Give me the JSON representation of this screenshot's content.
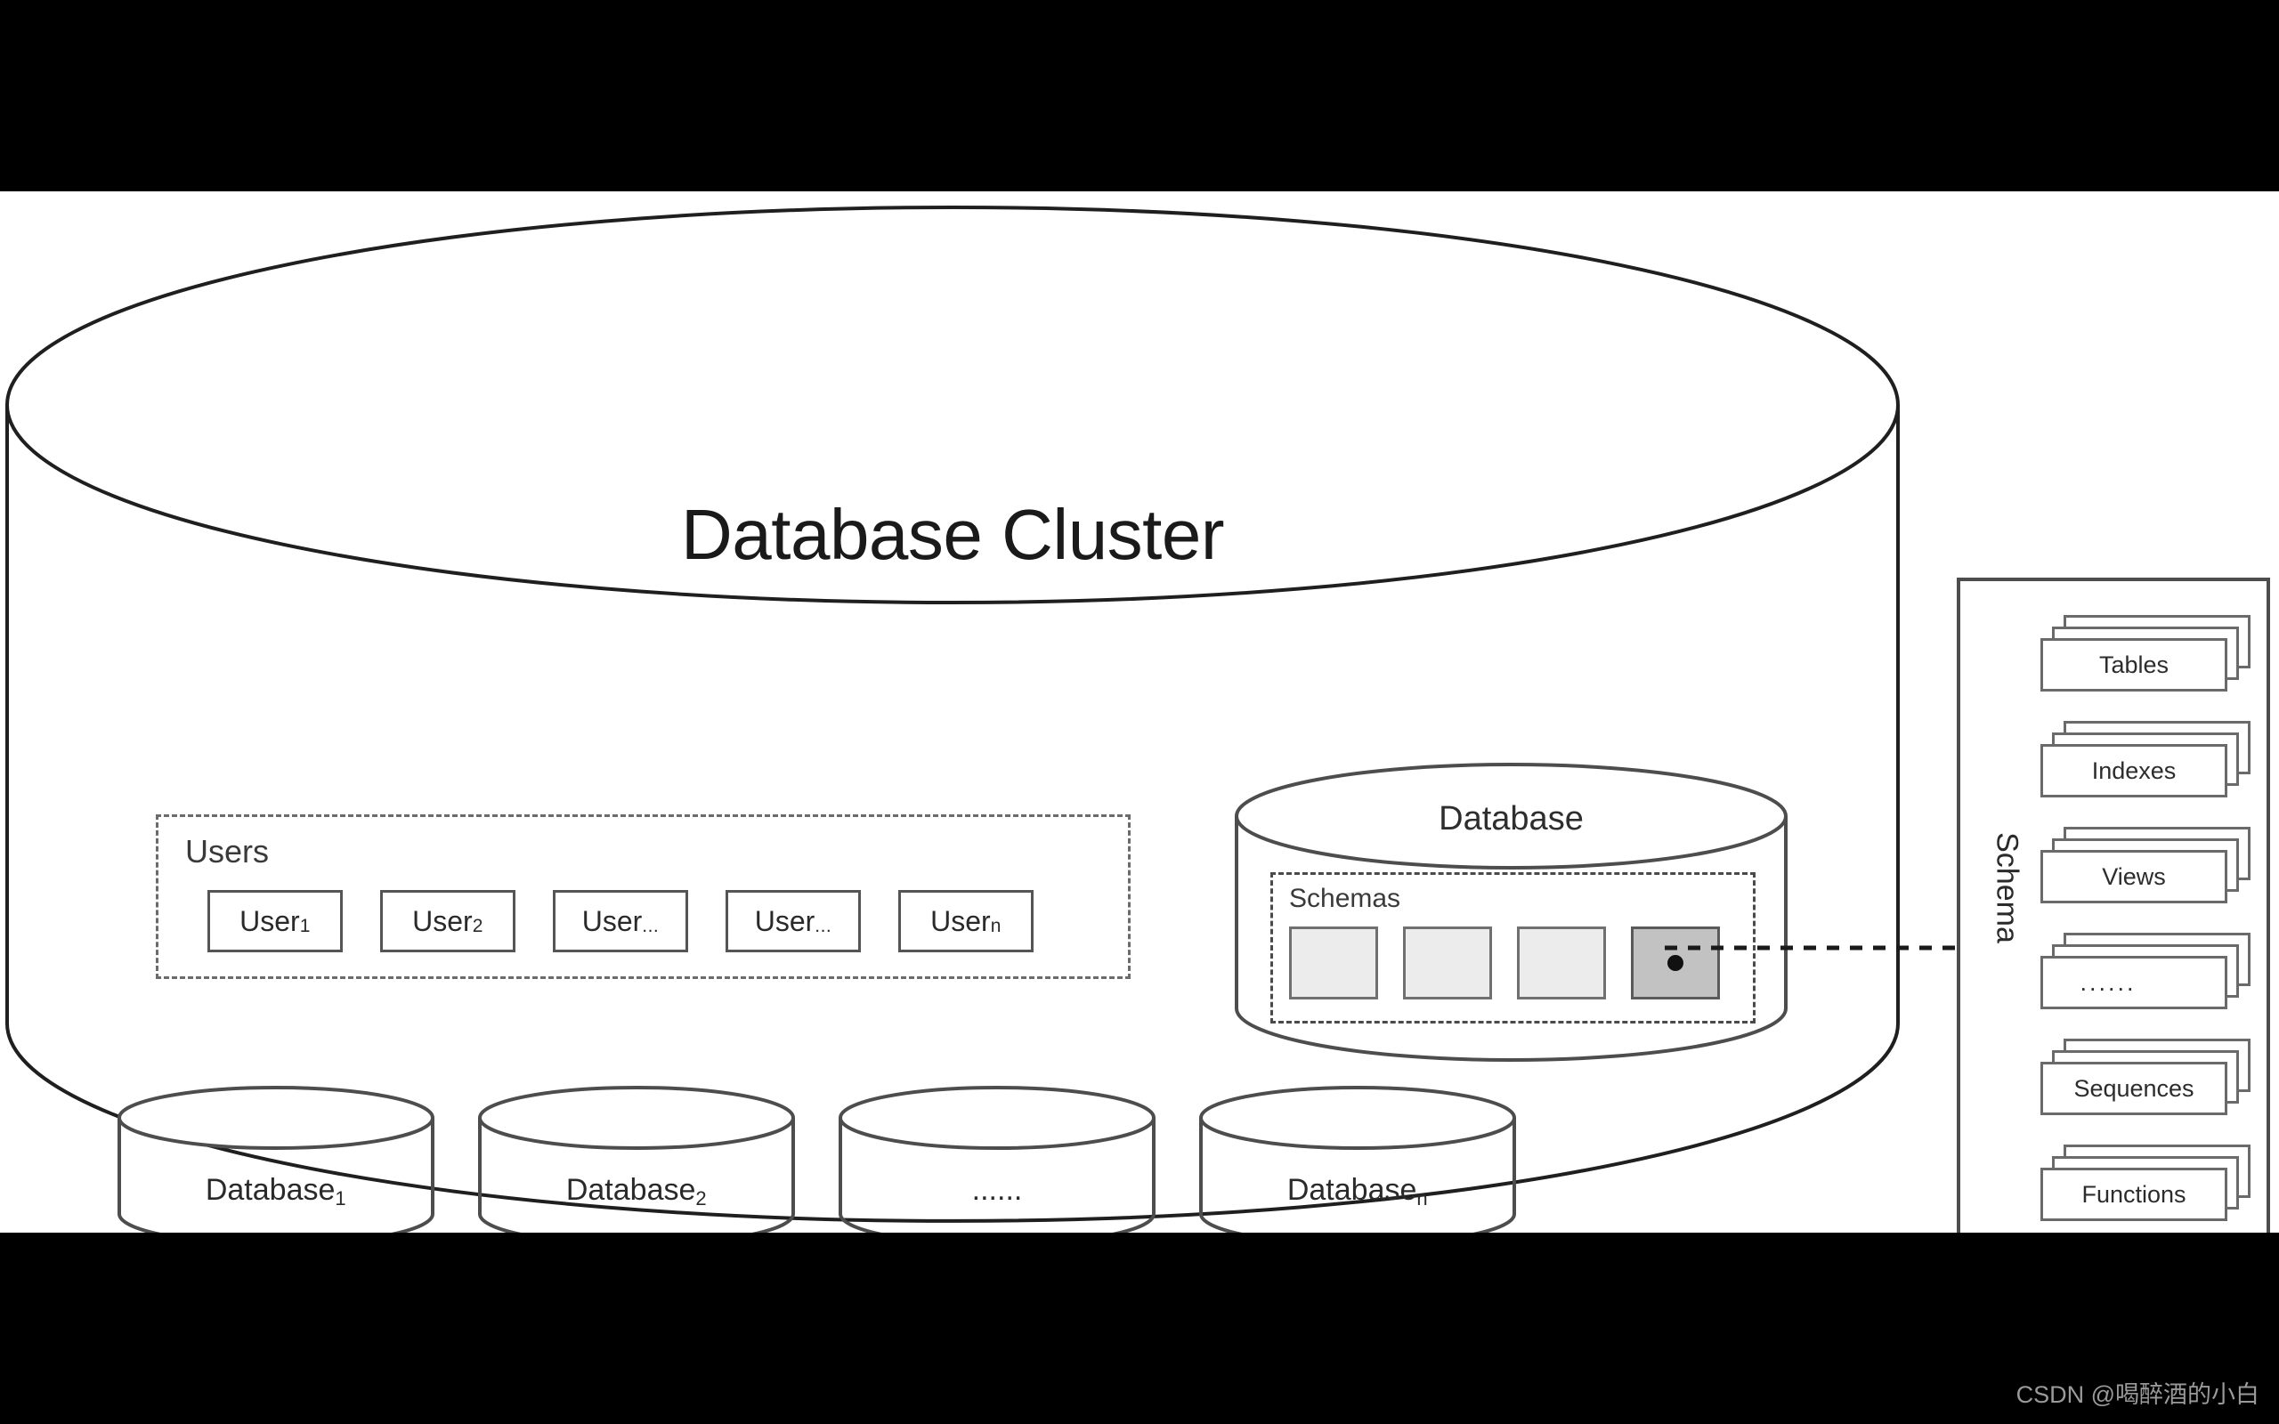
{
  "diagram": {
    "title": "Database Cluster",
    "cluster": {
      "users_group": {
        "label": "Users",
        "items": [
          {
            "base": "User",
            "sub": "1"
          },
          {
            "base": "User",
            "sub": "2"
          },
          {
            "base": "User",
            "sub": "..."
          },
          {
            "base": "User",
            "sub": "..."
          },
          {
            "base": "User",
            "sub": "n"
          }
        ]
      },
      "database_detail": {
        "label": "Database",
        "schemas_group": {
          "label": "Schemas",
          "boxes": [
            {
              "state": "normal"
            },
            {
              "state": "normal"
            },
            {
              "state": "normal"
            },
            {
              "state": "selected"
            }
          ]
        }
      },
      "databases": [
        {
          "base": "Database",
          "sub": "1"
        },
        {
          "base": "Database",
          "sub": "2"
        },
        {
          "base": "......",
          "sub": ""
        },
        {
          "base": "Database",
          "sub": "n"
        }
      ]
    },
    "schema_panel": {
      "side_label": "Schema",
      "cards": [
        {
          "label": "Tables"
        },
        {
          "label": "Indexes"
        },
        {
          "label": "Views"
        },
        {
          "label": "......"
        },
        {
          "label": "Sequences"
        },
        {
          "label": "Functions"
        }
      ]
    },
    "connector": {
      "kind": "dashed-arrow",
      "from": "selected-schema-box",
      "to": "schema-panel"
    },
    "watermark": "CSDN @喝醉酒的小白",
    "colors": {
      "stroke": "#4d4d4d",
      "stroke_dark": "#1a1a1a",
      "schema_box": "#ececec",
      "schema_box_selected": "#c2c2c2",
      "letterbox": "#000000",
      "canvas": "#ffffff",
      "watermark": "#9a9a9a"
    }
  }
}
